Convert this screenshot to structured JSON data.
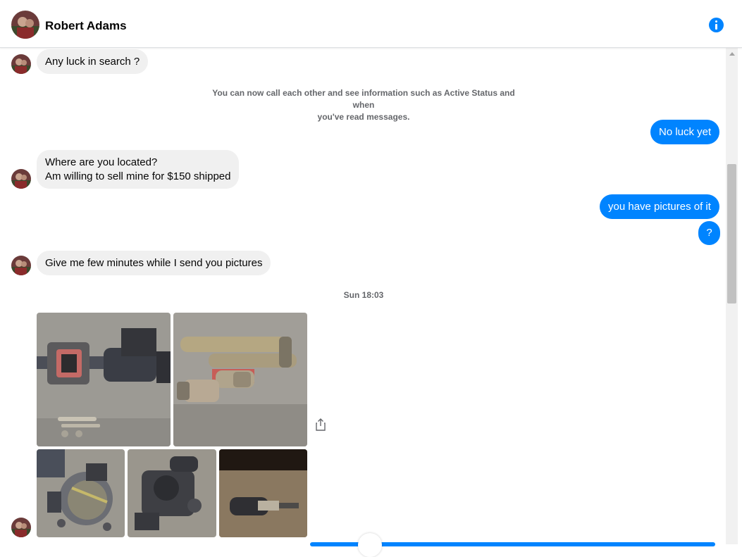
{
  "header": {
    "contact_name": "Robert Adams",
    "info_icon": "info-circle-icon"
  },
  "colors": {
    "accent": "#0084ff",
    "incoming_bubble": "#f0f0f0",
    "meta_text": "#65676b"
  },
  "messages": {
    "m1": "Any luck in search ?",
    "system_note_line1": "You can now call each other and see information such as Active Status and when",
    "system_note_line2": "you've read messages.",
    "m2": "No luck yet",
    "m3_line1": "Where are you located?",
    "m3_line2": "Am willing to sell mine for $150 shipped",
    "m4": "you have pictures of it",
    "m5": "?",
    "m6": "Give me few minutes while I send you pictures",
    "timestamp": "Sun 18:03"
  },
  "photos": {
    "share_icon": "share-icon",
    "count": 5
  }
}
